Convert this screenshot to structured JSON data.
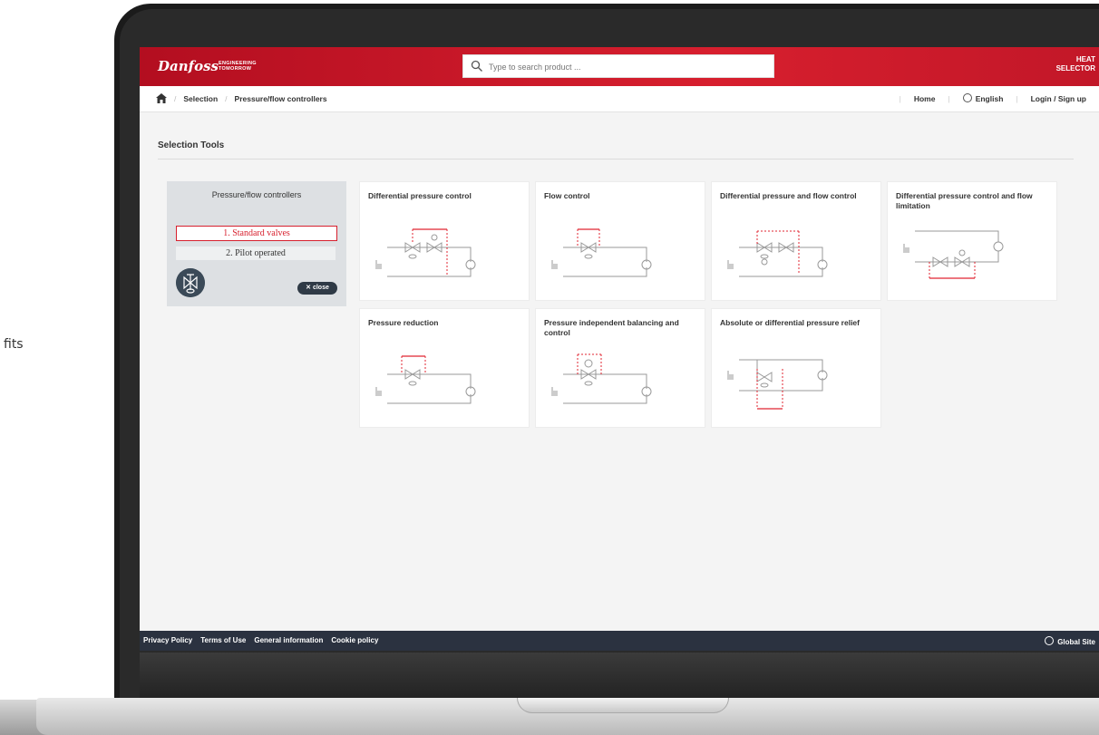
{
  "page_fragment": "fits",
  "header": {
    "logo": "Danfoss",
    "tagline": [
      "ENGINEERING",
      "TOMORROW"
    ],
    "search_placeholder": "Type to search product ...",
    "app_title": [
      "HEAT",
      "SELECTOR"
    ]
  },
  "breadcrumb": {
    "items": [
      "Selection",
      "Pressure/flow controllers"
    ]
  },
  "topnav": {
    "home": "Home",
    "language": "English",
    "login": "Login / Sign up"
  },
  "main": {
    "section_title": "Selection Tools",
    "side_panel": {
      "title": "Pressure/flow controllers",
      "options": [
        "1. Standard valves",
        "2. Pilot operated"
      ],
      "close_label": "close"
    },
    "cards": [
      {
        "title": "Differential pressure control"
      },
      {
        "title": "Flow control"
      },
      {
        "title": "Differential pressure and flow control"
      },
      {
        "title": "Differential pressure control and flow limitation"
      },
      {
        "title": "Pressure reduction"
      },
      {
        "title": "Pressure independent balancing and control"
      },
      {
        "title": "Absolute or differential pressure relief"
      }
    ]
  },
  "footer": {
    "links": [
      "Privacy Policy",
      "Terms of Use",
      "General information",
      "Cookie policy"
    ],
    "global_site": "Global Site"
  },
  "colors": {
    "brand_red": "#d7202e",
    "footer_bg": "#2b3240",
    "panel_bg": "#dde0e3"
  }
}
